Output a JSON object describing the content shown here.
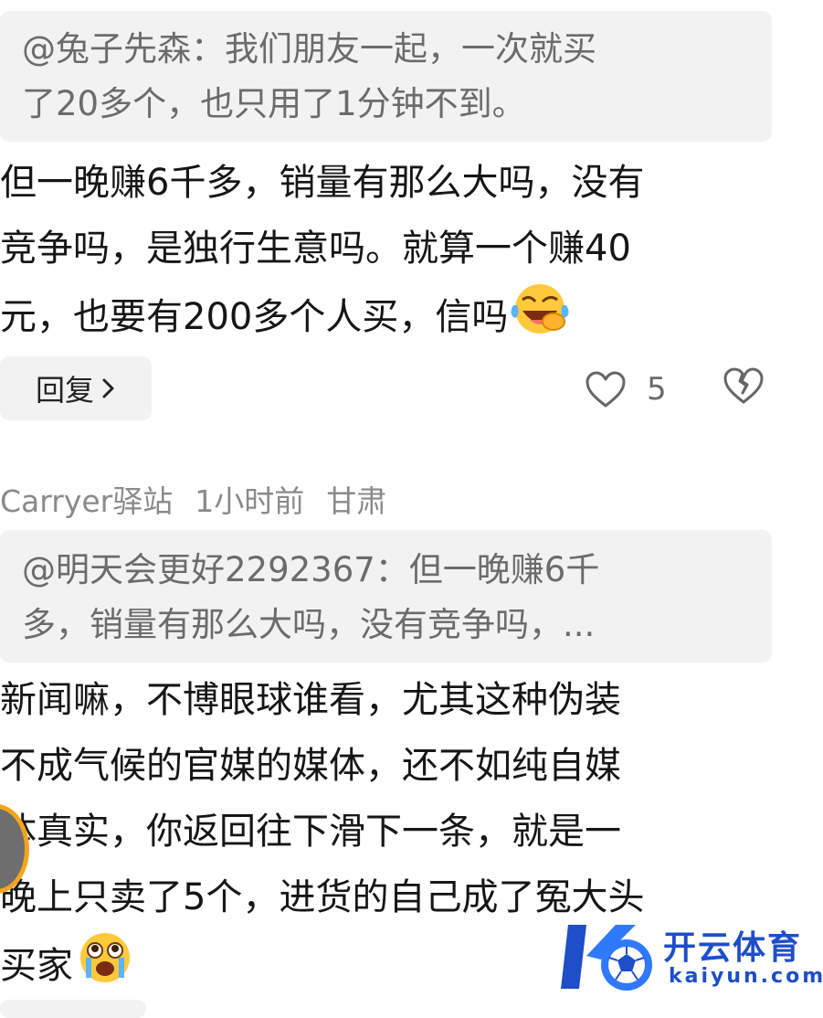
{
  "comment1": {
    "quote_lines": [
      "@兔子先森：我们朋友一起，一次就买",
      "了20多个，也只用了1分钟不到。"
    ],
    "body_lines": [
      "但一晚赚6千多，销量有那么大吗，没有",
      "竞争吗，是独行生意吗。就算一个赚40",
      "元，也要有200多个人买，信吗"
    ],
    "emoji": "laughing-crying-emoji",
    "reply_label": "回复",
    "like_count": "5"
  },
  "comment2": {
    "author": "Carryer驿站",
    "time": "1小时前",
    "location": "甘肃",
    "quote_lines": [
      "@明天会更好2292367：但一晚赚6千",
      "多，销量有那么大吗，没有竞争吗，..."
    ],
    "body_lines": [
      "新闻嘛，不博眼球谁看，尤其这种伪装",
      "不成气候的官媒的媒体，还不如纯自媒",
      "体真实，你返回往下滑下一条，就是一",
      "晚上只卖了5个，进货的自己成了冤大头",
      "买家"
    ],
    "emoji": "crying-emoji"
  },
  "watermark": {
    "brand": "开云体育",
    "domain": "kaiyun.com"
  },
  "colors": {
    "quote_bg": "#f2f2f2",
    "quote_text": "#6b6b6b",
    "meta_text": "#8a8a8a",
    "watermark_blue": "#1e4ec8"
  }
}
